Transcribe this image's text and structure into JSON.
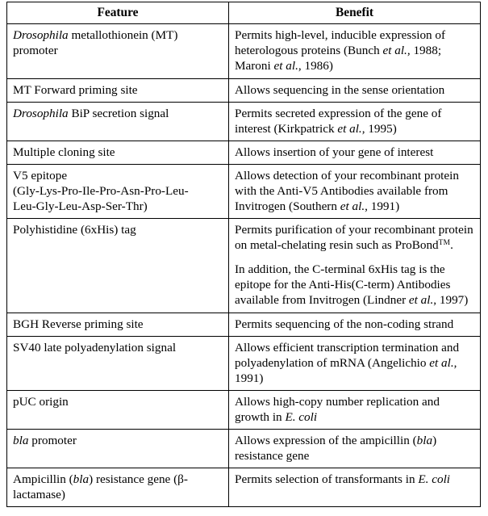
{
  "table": {
    "columns": [
      {
        "header": "Feature"
      },
      {
        "header": "Benefit"
      }
    ],
    "rows": [
      {
        "feature_plain": "Drosophila metallothionein (MT) promoter",
        "feature_italic_prefix": "Drosophila",
        "feature_rest": " metallothionein (MT) promoter",
        "benefit_plain": "Permits high-level, inducible expression of heterologous proteins (Bunch et al., 1988; Maroni et al., 1986)",
        "benefit_part1": "Permits high-level, inducible expression of heterologous proteins (Bunch ",
        "benefit_italic1": "et al.",
        "benefit_part2": ", 1988; Maroni ",
        "benefit_italic2": "et al.",
        "benefit_part3": ", 1986)"
      },
      {
        "feature_plain": "MT Forward priming site",
        "benefit_plain": "Allows sequencing in the sense orientation"
      },
      {
        "feature_plain": "Drosophila BiP secretion signal",
        "feature_italic_prefix": "Drosophila",
        "feature_rest": " BiP secretion signal",
        "benefit_plain": "Permits secreted expression of the gene of interest (Kirkpatrick et al., 1995)",
        "benefit_part1": "Permits secreted expression of the gene of interest (Kirkpatrick ",
        "benefit_italic1": "et al.",
        "benefit_part2": ", 1995)"
      },
      {
        "feature_plain": "Multiple cloning site",
        "benefit_plain": "Allows insertion of your gene of interest"
      },
      {
        "feature_plain": "V5 epitope (Gly-Lys-Pro-Ile-Pro-Asn-Pro-Leu-Leu-Gly-Leu-Asp-Ser-Thr)",
        "feature_line1": "V5 epitope",
        "feature_line2": "(Gly-Lys-Pro-Ile-Pro-Asn-Pro-Leu-",
        "feature_line3": "Leu-Gly-Leu-Asp-Ser-Thr)",
        "benefit_plain": "Allows detection of your recombinant protein with the Anti-V5 Antibodies available from Invitrogen (Southern et al., 1991)",
        "benefit_part1": "Allows detection of your recombinant protein with the Anti-V5 Antibodies available from Invitrogen (Southern ",
        "benefit_italic1": "et al.",
        "benefit_part2": ", 1991)"
      },
      {
        "feature_plain": "Polyhistidine (6xHis) tag",
        "benefit_para1_part1": "Permits purification of your recombinant protein on metal-chelating resin such as ProBond",
        "benefit_para1_tm": "TM",
        "benefit_para1_part2": ".",
        "benefit_para2_part1": "In addition, the C-terminal 6xHis tag is the epitope for the Anti-His(C-term) Antibodies available from Invitrogen (Lindner ",
        "benefit_para2_italic": "et al.",
        "benefit_para2_part2": ", 1997)"
      },
      {
        "feature_plain": "BGH Reverse priming site",
        "benefit_plain": "Permits sequencing of the non-coding strand"
      },
      {
        "feature_plain": "SV40 late polyadenylation signal",
        "benefit_plain": "Allows efficient transcription termination and polyadenylation of mRNA (Angelichio et al., 1991)",
        "benefit_part1": "Allows efficient transcription termination and polyadenylation of mRNA (Angelichio ",
        "benefit_italic1": "et al.",
        "benefit_part2": ", 1991)"
      },
      {
        "feature_plain": "pUC origin",
        "benefit_plain": "Allows high-copy number replication and growth in E. coli",
        "benefit_part1": "Allows high-copy number replication and growth in ",
        "benefit_italic1": "E. coli",
        "benefit_part2": ""
      },
      {
        "feature_plain": "bla promoter",
        "feature_italic_prefix": "bla",
        "feature_rest": " promoter",
        "benefit_plain": "Allows expression of the ampicillin (bla) resistance gene",
        "benefit_part1": "Allows expression of the ampicillin (",
        "benefit_italic1": "bla",
        "benefit_part2": ") resistance gene"
      },
      {
        "feature_plain": "Ampicillin (bla) resistance gene (β-lactamase)",
        "feature_part1": "Ampicillin (",
        "feature_italic1": "bla",
        "feature_part2": ") resistance gene (β-lactamase)",
        "benefit_plain": "Permits selection of transformants in E. coli",
        "benefit_part1": "Permits selection of transformants in ",
        "benefit_italic1": "E. coli",
        "benefit_part2": ""
      }
    ]
  }
}
